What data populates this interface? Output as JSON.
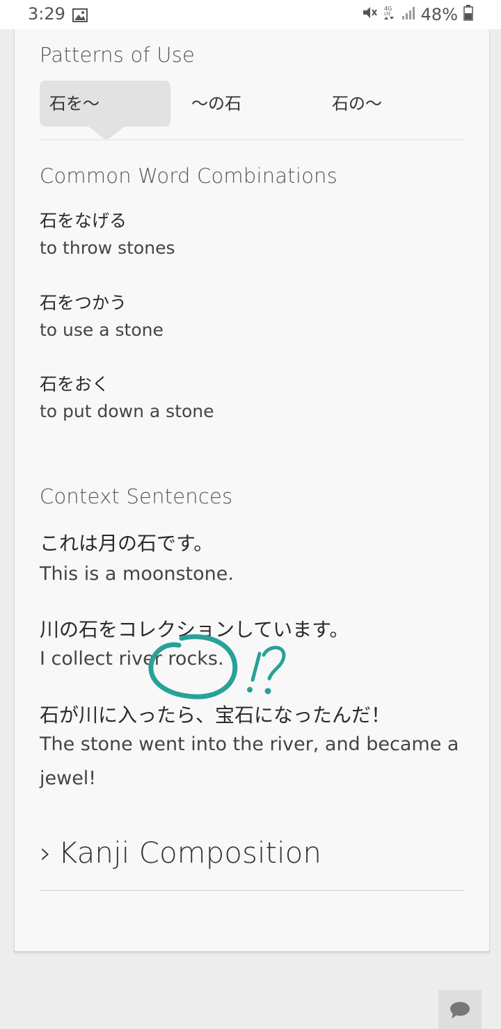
{
  "status_bar": {
    "time": "3:29",
    "battery": "48%"
  },
  "patterns": {
    "heading": "Patterns of Use",
    "tabs": [
      "石を〜",
      "〜の石",
      "石の〜"
    ],
    "active_tab": 0
  },
  "combinations": {
    "heading": "Common Word Combinations",
    "items": [
      {
        "jp": "石をなげる",
        "en": "to throw stones"
      },
      {
        "jp": "石をつかう",
        "en": "to use a stone"
      },
      {
        "jp": "石をおく",
        "en": "to put down a stone"
      }
    ]
  },
  "context": {
    "heading": "Context Sentences",
    "sentences": [
      {
        "jp": "これは月の石です。",
        "en": "This is a moonstone."
      },
      {
        "jp": "川の石をコレクションしています。",
        "en": "I collect river rocks."
      },
      {
        "jp": "石が川に入ったら、宝石になったんだ！",
        "en": "The stone went into the river, and became a",
        "en_2": "jewel!"
      }
    ]
  },
  "annotation": {
    "text": "!?",
    "color": "#2aa198"
  },
  "kanji_composition": {
    "label": "Kanji Composition",
    "chevron": "›"
  },
  "icons": {
    "chat": "chat-bubble-icon",
    "image": "image-icon",
    "mute": "mute-icon",
    "network": "4g-lte-icon",
    "signal": "signal-icon",
    "battery": "battery-icon"
  }
}
